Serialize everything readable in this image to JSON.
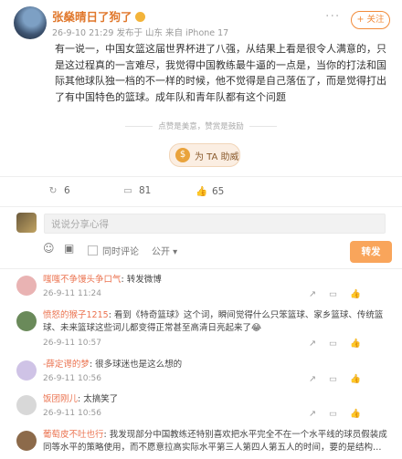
{
  "post": {
    "author": "张燊晴日了狗了",
    "meta": "26-9-10 21:29  发布于 山东  来自 iPhone 17",
    "follow": "+ 关注",
    "more": "···",
    "body": "有一说一，中国女篮这届世界杯进了八强，从结果上看是很令人满意的，只是这过程真的一言难尽，我觉得中国教练最牛逼的一点是，当你的打法和国际其他球队独一档的不一样的时候，他不觉得是自己落伍了，而是觉得打出了有中国特色的篮球。成年队和青年队都有这个问题",
    "tips": "点赞是美意，赞赏是鼓励",
    "tip_button": "为 TA 助威",
    "tip_coin": "$",
    "actions": {
      "share": "6",
      "comments": "81",
      "likes": "65"
    }
  },
  "composer": {
    "placeholder": "说说分享心得",
    "emoji_icon": "☺",
    "image_icon": "▣",
    "cross_post": "同时评论",
    "visibility": "公开 ▾",
    "send": "转发"
  },
  "comments": [
    {
      "user": "嗤嗤不争馒头争口气",
      "text": ": 转发微博",
      "time": "26-9-11 11:24",
      "likes": ""
    },
    {
      "user": "愤怒的猴子1215",
      "text": ": 看到《特奇篮球》这个词，瞬间觉得什么只笨篮球、家乡篮球、传统篮球、未来篮球这些词儿都变得正常甚至高清日亮起来了😂",
      "time": "26-9-11 10:57",
      "likes": ""
    },
    {
      "user": "-薛定谔的梦",
      "text": ": 很多球迷也是这么想的",
      "time": "26-9-11 10:56",
      "likes": ""
    },
    {
      "user": "饭团刚儿",
      "text": ": 太搞笑了",
      "time": "26-9-11 10:56",
      "likes": ""
    },
    {
      "user": "葡萄皮不吐也行",
      "text": ": 我发现部分中国教练还特别喜欢把水平完全不在一个水平线的球员假装成同等水平的策略使用，而不愿意拉高实际水平第三人第四人第五人的时间，要的是结构…",
      "time": "",
      "likes": ""
    }
  ],
  "comment_ops": {
    "share": "↗",
    "reply": "▭",
    "like": "👍"
  }
}
